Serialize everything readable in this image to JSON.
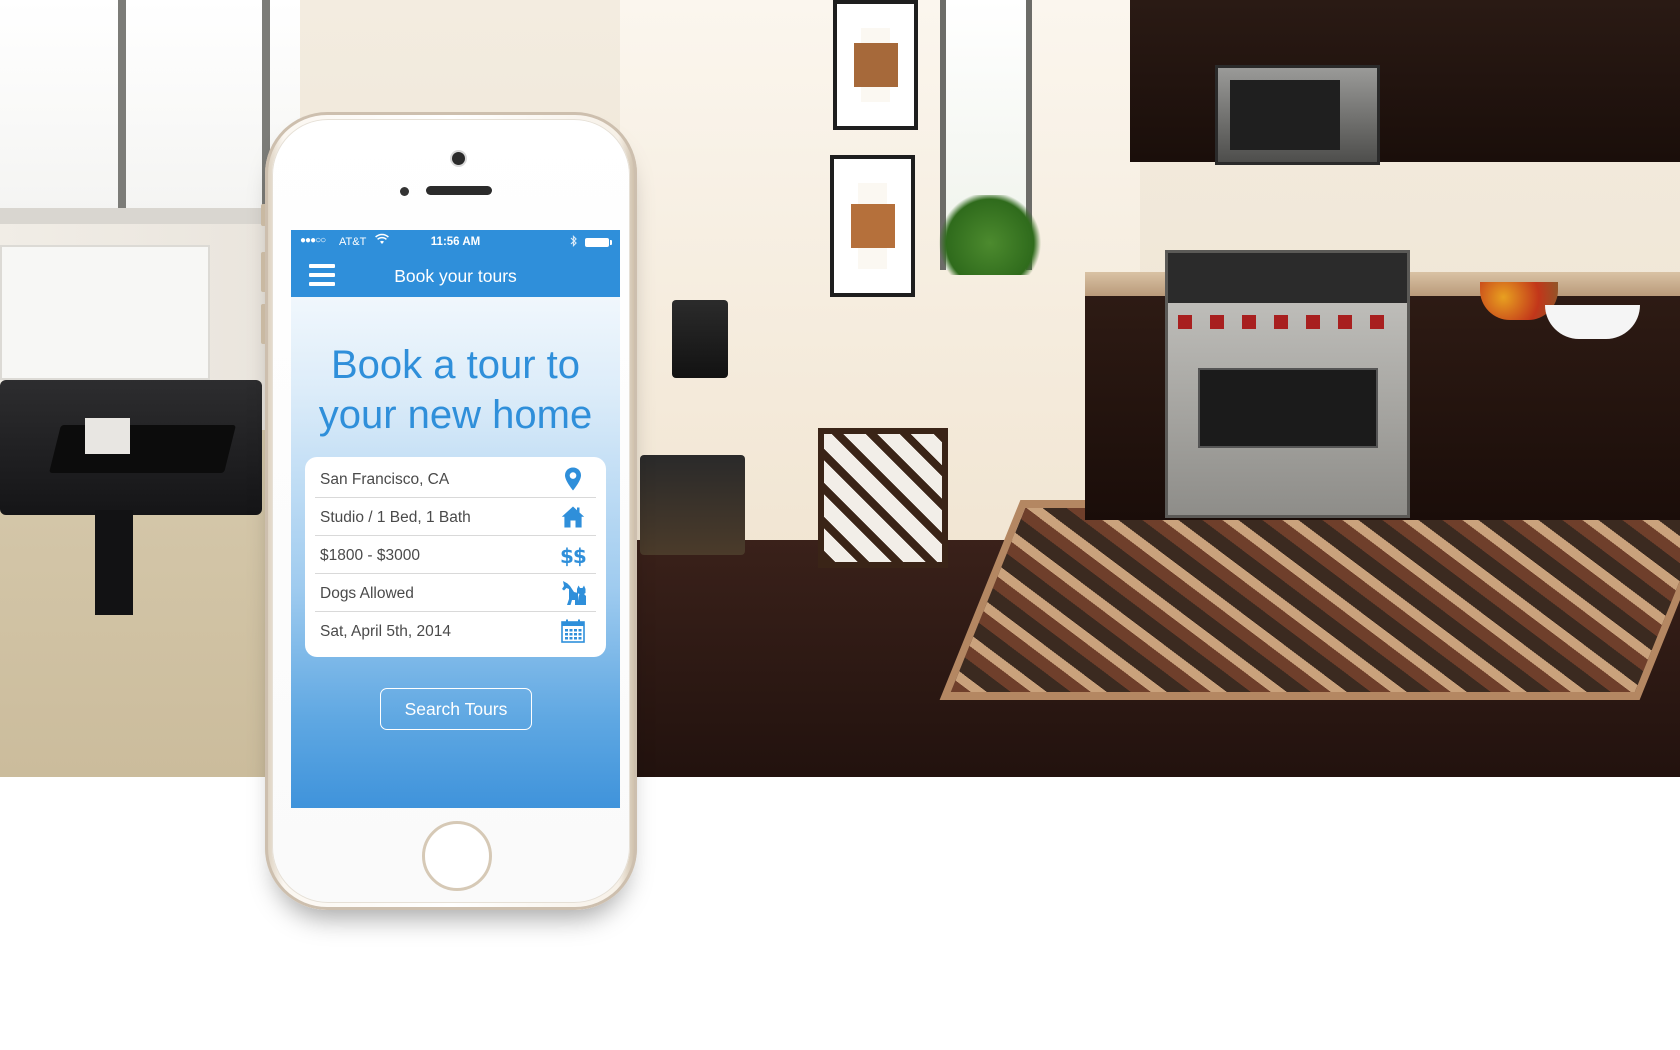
{
  "colors": {
    "accent": "#2f8fda",
    "icon": "#2f8fda",
    "card": "#ffffff",
    "text": "#4a4a4a"
  },
  "status_bar": {
    "signal": "●●●○○",
    "carrier": "AT&T",
    "wifi_icon": "wifi-icon",
    "time": "11:56 AM",
    "bluetooth_icon": "bluetooth-icon",
    "battery_icon": "battery-icon"
  },
  "nav": {
    "menu_icon": "hamburger-menu-icon",
    "title": "Book your tours"
  },
  "hero": {
    "line1": "Book a tour to",
    "line2": "your new home"
  },
  "form": {
    "fields": [
      {
        "value": "San Francisco, CA",
        "icon": "location-pin-icon"
      },
      {
        "value": "Studio / 1 Bed, 1 Bath",
        "icon": "house-icon"
      },
      {
        "value": "$1800 - $3000",
        "icon": "dollar-signs-icon"
      },
      {
        "value": "Dogs Allowed",
        "icon": "pet-icon"
      },
      {
        "value": "Sat, April 5th, 2014",
        "icon": "calendar-icon"
      }
    ]
  },
  "actions": {
    "search_label": "Search Tours"
  }
}
